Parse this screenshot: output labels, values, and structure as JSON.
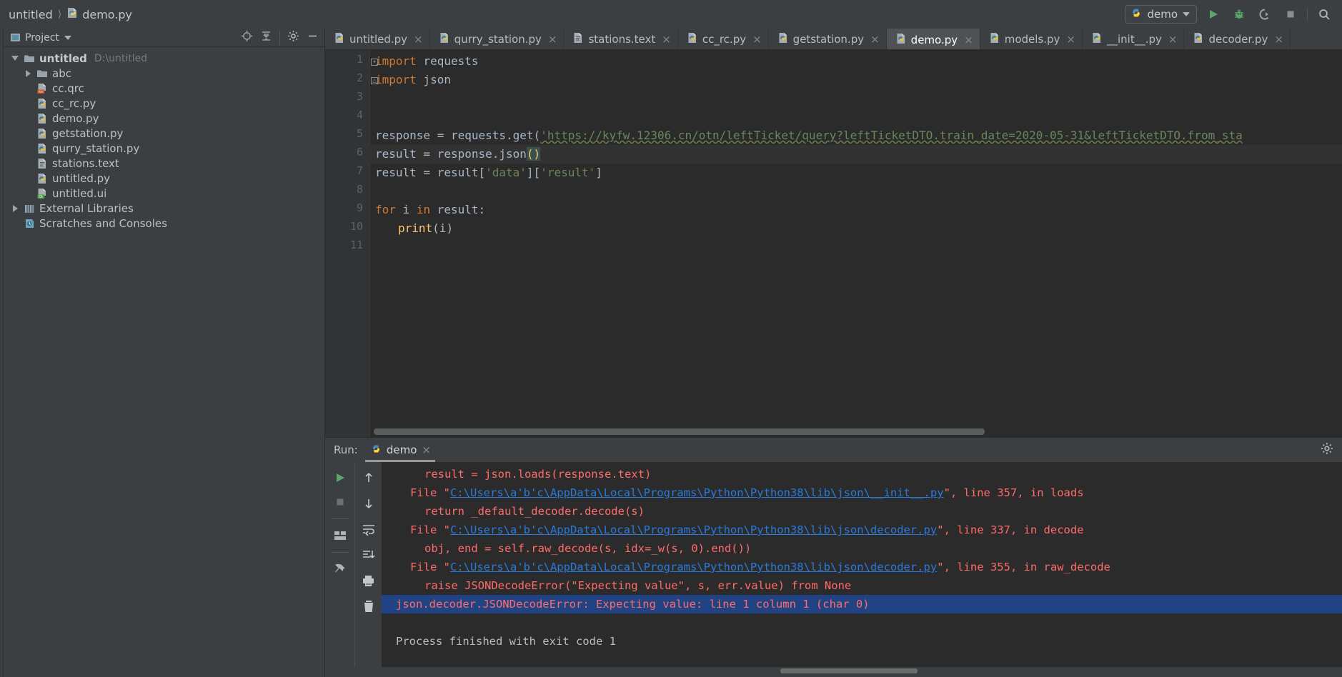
{
  "window": {
    "breadcrumb": [
      "untitled",
      "demo.py"
    ],
    "project_name": "untitled",
    "project_path": "D:\\untitled"
  },
  "toolbar": {
    "run_config_label": "demo",
    "run_button": "run",
    "debug_button": "debug",
    "coverage_button": "run-with-coverage",
    "stop_button": "stop",
    "search_button": "search"
  },
  "project_pane": {
    "title": "Project",
    "action_locate": "locate-in-tree",
    "action_collapse": "collapse-all",
    "action_settings": "settings",
    "action_hide": "hide",
    "tree": [
      {
        "label": "untitled",
        "sub": "D:\\untitled",
        "icon": "folder-icon",
        "indent": 0,
        "expanded": true,
        "bold": true
      },
      {
        "label": "abc",
        "sub": "",
        "icon": "folder-icon",
        "indent": 1,
        "expanded": false,
        "bold": false
      },
      {
        "label": "cc.qrc",
        "sub": "",
        "icon": "qrc-file-icon",
        "indent": 1,
        "expanded": null,
        "bold": false
      },
      {
        "label": "cc_rc.py",
        "sub": "",
        "icon": "python-file-icon",
        "indent": 1,
        "expanded": null,
        "bold": false
      },
      {
        "label": "demo.py",
        "sub": "",
        "icon": "python-file-icon",
        "indent": 1,
        "expanded": null,
        "bold": false
      },
      {
        "label": "getstation.py",
        "sub": "",
        "icon": "python-file-icon",
        "indent": 1,
        "expanded": null,
        "bold": false
      },
      {
        "label": "qurry_station.py",
        "sub": "",
        "icon": "python-file-icon",
        "indent": 1,
        "expanded": null,
        "bold": false
      },
      {
        "label": "stations.text",
        "sub": "",
        "icon": "text-file-icon",
        "indent": 1,
        "expanded": null,
        "bold": false
      },
      {
        "label": "untitled.py",
        "sub": "",
        "icon": "python-file-icon",
        "indent": 1,
        "expanded": null,
        "bold": false
      },
      {
        "label": "untitled.ui",
        "sub": "",
        "icon": "qt-ui-file-icon",
        "indent": 1,
        "expanded": null,
        "bold": false
      },
      {
        "label": "External Libraries",
        "sub": "",
        "icon": "library-icon",
        "indent": 0,
        "expanded": false,
        "bold": false
      },
      {
        "label": "Scratches and Consoles",
        "sub": "",
        "icon": "scratches-icon",
        "indent": 0,
        "expanded": null,
        "bold": false
      }
    ]
  },
  "editor": {
    "tabs": [
      {
        "label": "untitled.py",
        "icon": "python-file-icon",
        "active": false
      },
      {
        "label": "qurry_station.py",
        "icon": "python-file-icon",
        "active": false
      },
      {
        "label": "stations.text",
        "icon": "text-file-icon",
        "active": false
      },
      {
        "label": "cc_rc.py",
        "icon": "python-file-icon",
        "active": false
      },
      {
        "label": "getstation.py",
        "icon": "python-file-icon",
        "active": false
      },
      {
        "label": "demo.py",
        "icon": "python-file-icon",
        "active": true
      },
      {
        "label": "models.py",
        "icon": "python-file-icon",
        "active": false
      },
      {
        "label": "__init__.py",
        "icon": "python-file-icon",
        "active": false
      },
      {
        "label": "decoder.py",
        "icon": "python-file-icon",
        "active": false
      }
    ],
    "close_glyph": "×",
    "line_numbers": [
      "1",
      "2",
      "3",
      "4",
      "5",
      "6",
      "7",
      "8",
      "9",
      "10",
      "11"
    ],
    "current_line": 6,
    "code": {
      "l1_kw": "import",
      "l1_rest": " requests",
      "l2_kw": "import",
      "l2_rest": " json",
      "l5_pre": "response = requests.get(",
      "l5_url": "'https://kyfw.12306.cn/otn/leftTicket/query?leftTicketDTO.train_date=2020-05-31&leftTicketDTO.from_sta",
      "l6_pre": "result = response.json",
      "l6_paren": "()",
      "l7_pre": "result = result[",
      "l7_s1": "'data'",
      "l7_mid": "][",
      "l7_s2": "'result'",
      "l7_post": "]",
      "l9_kw1": "for",
      "l9_mid": " i ",
      "l9_kw2": "in",
      "l9_rest": " result:",
      "l10_fn": "print",
      "l10_rest": "(i)"
    }
  },
  "run_panel": {
    "label": "Run:",
    "tab_label": "demo",
    "close_glyph": "×",
    "settings_icon": "gear-icon",
    "tools": [
      "rerun-button",
      "stop-button",
      "restore-layout-button",
      "pin-tab-button",
      "up-stack-button",
      "down-stack-button",
      "soft-wrap-button",
      "scroll-to-end-button",
      "print-button",
      "clear-all-button"
    ],
    "console_lines": [
      {
        "indent": 4,
        "type": "err",
        "text": "result = json.loads(response.text)"
      },
      {
        "indent": 2,
        "type": "file",
        "prefix": "File \"",
        "link": "C:\\Users\\a'b'c\\AppData\\Local\\Programs\\Python\\Python38\\lib\\json\\__init__.py",
        "suffix": "\", line 357, in loads"
      },
      {
        "indent": 4,
        "type": "err",
        "text": "return _default_decoder.decode(s)"
      },
      {
        "indent": 2,
        "type": "file",
        "prefix": "File \"",
        "link": "C:\\Users\\a'b'c\\AppData\\Local\\Programs\\Python\\Python38\\lib\\json\\decoder.py",
        "suffix": "\", line 337, in decode"
      },
      {
        "indent": 4,
        "type": "err",
        "text": "obj, end = self.raw_decode(s, idx=_w(s, 0).end())"
      },
      {
        "indent": 2,
        "type": "file",
        "prefix": "File \"",
        "link": "C:\\Users\\a'b'c\\AppData\\Local\\Programs\\Python\\Python38\\lib\\json\\decoder.py",
        "suffix": "\", line 355, in raw_decode"
      },
      {
        "indent": 4,
        "type": "err",
        "text": "raise JSONDecodeError(\"Expecting value\", s, err.value) from None"
      },
      {
        "indent": 0,
        "type": "err-selected",
        "text": "json.decoder.JSONDecodeError: Expecting value: line 1 column 1 (char 0)"
      },
      {
        "indent": 0,
        "type": "blank",
        "text": ""
      },
      {
        "indent": 0,
        "type": "plain",
        "text": "Process finished with exit code 1"
      }
    ]
  },
  "colors": {
    "background": "#3c3f41",
    "editor_bg": "#2b2b2b",
    "keyword": "#cc7832",
    "string": "#6a8759",
    "function": "#ffc66d",
    "plain_text": "#a9b7c6",
    "error_red": "#ff6b68",
    "link_blue": "#287bde",
    "selection_blue": "#214283",
    "accent_green": "#499c54"
  }
}
